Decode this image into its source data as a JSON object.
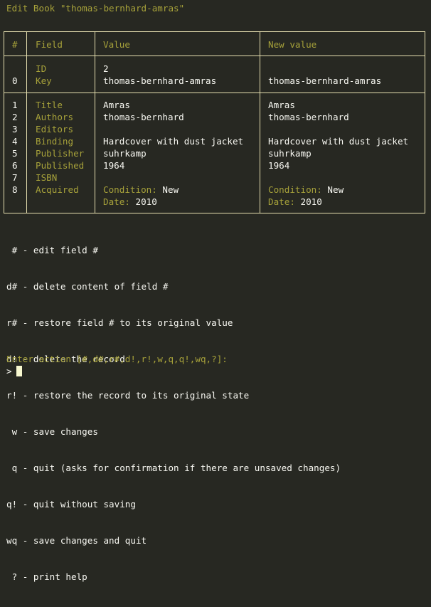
{
  "title": "Edit Book \"thomas-bernhard-amras\"",
  "table": {
    "headers": [
      "#",
      "Field",
      "Value",
      "New value"
    ],
    "id_row": {
      "field": "ID",
      "value": "2",
      "new_value": ""
    },
    "key_row": {
      "num": "0",
      "field": "Key",
      "value": "thomas-bernhard-amras",
      "new_value": "thomas-bernhard-amras"
    },
    "rows": [
      {
        "num": "1",
        "field": "Title",
        "value": "Amras",
        "new_value": "Amras"
      },
      {
        "num": "2",
        "field": "Authors",
        "value": "thomas-bernhard",
        "new_value": "thomas-bernhard"
      },
      {
        "num": "3",
        "field": "Editors",
        "value": "",
        "new_value": ""
      },
      {
        "num": "4",
        "field": "Binding",
        "value": "Hardcover with dust jacket",
        "new_value": "Hardcover with dust jacket"
      },
      {
        "num": "5",
        "field": "Publisher",
        "value": "suhrkamp",
        "new_value": "suhrkamp"
      },
      {
        "num": "6",
        "field": "Published",
        "value": "1964",
        "new_value": "1964"
      },
      {
        "num": "7",
        "field": "ISBN",
        "value": "",
        "new_value": ""
      },
      {
        "num": "8",
        "field": "Acquired",
        "value": "",
        "new_value": ""
      }
    ],
    "acquired": {
      "condition_label": "Condition:",
      "condition_value": "New",
      "date_label": "Date:",
      "date_value": "2010",
      "new_condition_value": "New",
      "new_date_value": "2010"
    }
  },
  "help": [
    " # - edit field #",
    "d# - delete content of field #",
    "r# - restore field # to its original value",
    "d! - delete the record",
    "r! - restore the record to its original state",
    " w - save changes",
    " q - quit (asks for confirmation if there are unsaved changes)",
    "q! - quit without saving",
    "wq - save changes and quit",
    " ? - print help"
  ],
  "prompt": "Enter action [#,d#,r#,d!,r!,w,q,q!,wq,?]:",
  "input_prefix": ">",
  "input_value": "",
  "colors": {
    "background": "#272822",
    "accent": "#a6a13a",
    "border": "#e6dfb0",
    "text": "#f8f8f2"
  }
}
